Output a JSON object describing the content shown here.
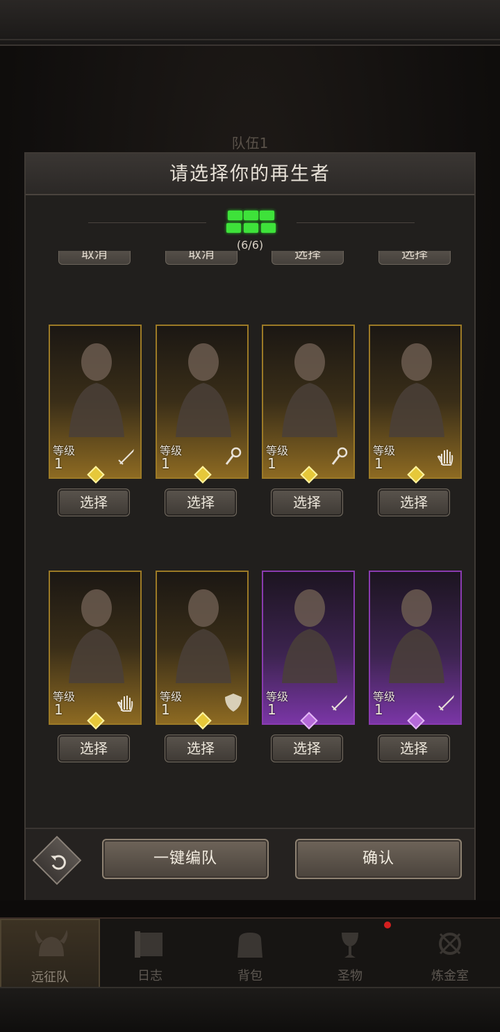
{
  "background": {
    "team_label": "队伍1"
  },
  "modal": {
    "title": "请选择你的再生者",
    "selection_count": "(6/6)",
    "partial_buttons": [
      "取消",
      "取消",
      "选择",
      "选择"
    ],
    "level_label": "等级",
    "heroes": [
      {
        "level": "1",
        "rarity": "gold",
        "class_icon": "sword-icon",
        "select_label": "选择"
      },
      {
        "level": "1",
        "rarity": "gold",
        "class_icon": "staff-icon",
        "select_label": "选择"
      },
      {
        "level": "1",
        "rarity": "gold",
        "class_icon": "staff-icon",
        "select_label": "选择"
      },
      {
        "level": "1",
        "rarity": "gold",
        "class_icon": "hand-icon",
        "select_label": "选择"
      },
      {
        "level": "1",
        "rarity": "gold",
        "class_icon": "hand-icon",
        "select_label": "选择"
      },
      {
        "level": "1",
        "rarity": "gold",
        "class_icon": "shield-icon",
        "select_label": "选择"
      },
      {
        "level": "1",
        "rarity": "purple",
        "class_icon": "sword-icon",
        "select_label": "选择"
      },
      {
        "level": "1",
        "rarity": "purple",
        "class_icon": "sword-icon",
        "select_label": "选择"
      }
    ],
    "footer": {
      "auto_team_label": "一键编队",
      "confirm_label": "确认"
    }
  },
  "nav": {
    "items": [
      {
        "label": "远征队",
        "icon": "viking-helmet-icon",
        "active": true
      },
      {
        "label": "日志",
        "icon": "scroll-icon",
        "active": false
      },
      {
        "label": "背包",
        "icon": "bag-icon",
        "active": false
      },
      {
        "label": "圣物",
        "icon": "chalice-icon",
        "active": false
      },
      {
        "label": "炼金室",
        "icon": "alchemy-icon",
        "active": false
      }
    ]
  },
  "colors": {
    "accent_green": "#3ee23a",
    "gold": "#9c7a26",
    "purple": "#8a3bb0",
    "notification": "#d41f1f"
  }
}
